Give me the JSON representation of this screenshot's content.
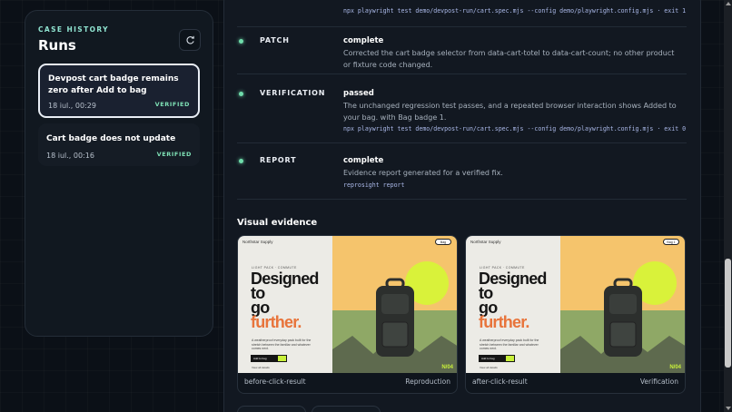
{
  "sidebar": {
    "eyebrow": "CASE HISTORY",
    "title": "Runs",
    "refresh_icon": "refresh-icon",
    "runs": [
      {
        "title": "Devpost cart badge remains zero after Add to bag",
        "date": "18 iul., 00:29",
        "status": "VERIFIED"
      },
      {
        "title": "Cart badge does not update",
        "date": "18 iul., 00:16",
        "status": "VERIFIED"
      }
    ]
  },
  "top_command": "npx playwright test demo/devpost-run/cart.spec.mjs --config demo/playwright.config.mjs · exit 1",
  "steps": [
    {
      "name": "PATCH",
      "status": "complete",
      "desc": "Corrected the cart badge selector from data-cart-totel to data-cart-count; no other product or fixture code changed.",
      "command": ""
    },
    {
      "name": "VERIFICATION",
      "status": "passed",
      "desc": "The unchanged regression test passes, and a repeated browser interaction shows Added to your bag. with Bag badge 1.",
      "command": "npx playwright test demo/devpost-run/cart.spec.mjs --config demo/playwright.config.mjs · exit 0"
    },
    {
      "name": "REPORT",
      "status": "complete",
      "desc": "Evidence report generated for a verified fix.",
      "command": "reprosight report"
    }
  ],
  "evidence": {
    "title": "Visual evidence",
    "cards": [
      {
        "name": "before-click-result",
        "kind": "Reproduction",
        "badge": "Bag",
        "counter": "N/04"
      },
      {
        "name": "after-click-result",
        "kind": "Verification",
        "badge": "Bag 1",
        "counter": "N/04"
      }
    ],
    "shot": {
      "brand": "Northstar Supply",
      "kicker": "LIGHT PACK · COMMUTE",
      "headline_1": "Designed",
      "headline_2": "to",
      "headline_3": "go",
      "headline_4": "further.",
      "copy": "A weatherproof everyday pack built for the stretch between the familiar and whatever comes next.",
      "button": "Add to bag",
      "link": "View all details"
    }
  },
  "colors": {
    "accent": "#6fdcab",
    "eyebrow": "#8fe3d0",
    "headline_orange": "#e8743b",
    "lime": "#c8f03a"
  }
}
